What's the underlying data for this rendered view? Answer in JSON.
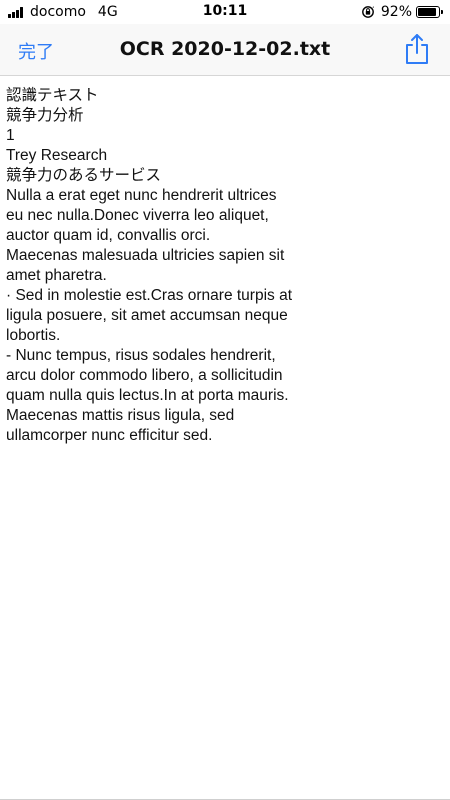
{
  "status_bar": {
    "carrier": "docomo",
    "network": "4G",
    "time": "10:11",
    "battery_percent_label": "92%",
    "battery_level": 0.92,
    "icons": [
      "signal-icon",
      "orientation-lock-icon",
      "battery-icon"
    ]
  },
  "nav": {
    "done_label": "完了",
    "title": "OCR 2020-12-02.txt",
    "accent_color": "#2f7cf6",
    "share_icon": "share-icon"
  },
  "document": {
    "lines": [
      "認識テキスト",
      "競争力分析",
      "1",
      "Trey Research",
      "競争力のあるサービス",
      "Nulla a erat eget nunc hendrerit ultrices",
      "eu nec nulla.Donec viverra leo aliquet,",
      "auctor quam id, convallis orci.",
      "Maecenas malesuada ultricies sapien sit",
      "amet pharetra.",
      "· Sed in molestie est.Cras ornare turpis at",
      "ligula posuere, sit amet accumsan neque",
      "lobortis.",
      "- Nunc tempus, risus sodales hendrerit,",
      "arcu dolor commodo libero, a sollicitudin",
      "quam nulla quis lectus.In at porta mauris.",
      "Maecenas mattis risus ligula, sed",
      "ullamcorper nunc efficitur sed."
    ]
  }
}
